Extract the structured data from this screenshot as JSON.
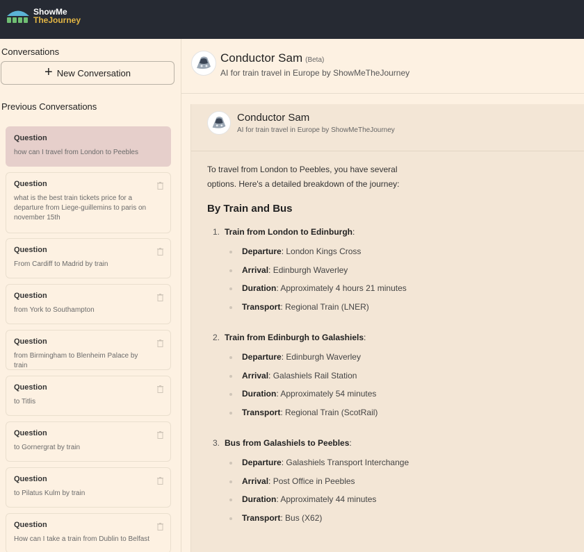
{
  "brand": {
    "line1": "ShowMe",
    "line2": "TheJourney"
  },
  "sidebar": {
    "title": "Conversations",
    "new_label": "New Conversation",
    "prev_title": "Previous Conversations",
    "conversations": [
      {
        "label": "Question",
        "text": "how can I travel from London to Peebles"
      },
      {
        "label": "Question",
        "text": "what is the best train tickets price for a departure from Liege-guillemins to paris on november 15th"
      },
      {
        "label": "Question",
        "text": "From Cardiff to Madrid by train"
      },
      {
        "label": "Question",
        "text": "from York to Southampton"
      },
      {
        "label": "Question",
        "text": "from Birmingham to Blenheim Palace by train"
      },
      {
        "label": "Question",
        "text": "to Titlis"
      },
      {
        "label": "Question",
        "text": "to Gornergrat by train"
      },
      {
        "label": "Question",
        "text": "to Pilatus Kulm by train"
      },
      {
        "label": "Question",
        "text": "How can I take a train from Dublin to Belfast"
      }
    ]
  },
  "header": {
    "name": "Conductor Sam",
    "beta": "(Beta)",
    "subtitle": "AI for train travel in Europe by ShowMeTheJourney"
  },
  "chat": {
    "name": "Conductor Sam",
    "subtitle": "AI for train travel in Europe by ShowMeTheJourney",
    "intro": "To travel from London to Peebles, you have several options. Here's a detailed breakdown of the journey:",
    "section_title": "By Train and Bus",
    "steps": [
      {
        "num": "1.",
        "title": "Train from London to Edinburgh",
        "items": [
          {
            "k": "Departure",
            "v": "London Kings Cross"
          },
          {
            "k": "Arrival",
            "v": "Edinburgh Waverley"
          },
          {
            "k": "Duration",
            "v": "Approximately 4 hours 21 minutes"
          },
          {
            "k": "Transport",
            "v": "Regional Train (LNER)"
          }
        ]
      },
      {
        "num": "2.",
        "title": "Train from Edinburgh to Galashiels",
        "items": [
          {
            "k": "Departure",
            "v": "Edinburgh Waverley"
          },
          {
            "k": "Arrival",
            "v": "Galashiels Rail Station"
          },
          {
            "k": "Duration",
            "v": "Approximately 54 minutes"
          },
          {
            "k": "Transport",
            "v": "Regional Train (ScotRail)"
          }
        ]
      },
      {
        "num": "3.",
        "title": "Bus from Galashiels to Peebles",
        "items": [
          {
            "k": "Departure",
            "v": "Galashiels Transport Interchange"
          },
          {
            "k": "Arrival",
            "v": "Post Office in Peebles"
          },
          {
            "k": "Duration",
            "v": "Approximately 44 minutes"
          },
          {
            "k": "Transport",
            "v": "Bus (X62)"
          }
        ]
      }
    ]
  }
}
